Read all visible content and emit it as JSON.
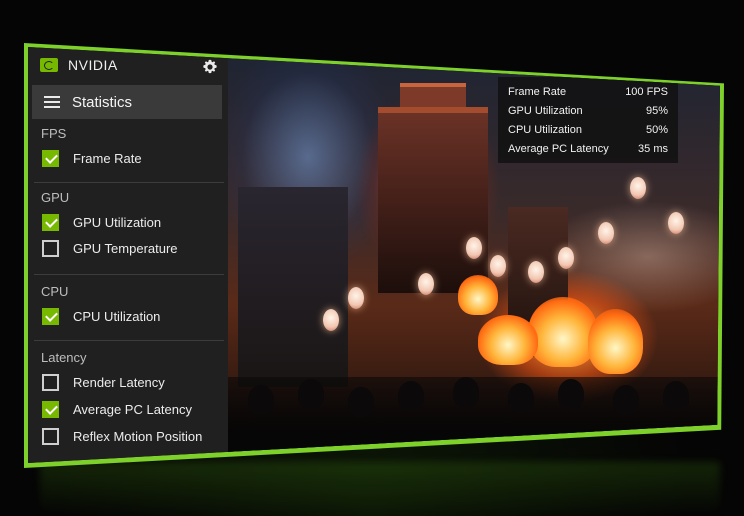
{
  "app": {
    "brand": "NVIDIA",
    "accent_color": "#76b900",
    "menu_icon": "hamburger-menu-icon",
    "settings_icon": "gear-icon"
  },
  "panel": {
    "title": "Statistics",
    "sections": [
      {
        "label": "FPS",
        "options": [
          {
            "label": "Frame Rate",
            "checked": true
          }
        ]
      },
      {
        "label": "GPU",
        "options": [
          {
            "label": "GPU Utilization",
            "checked": true
          },
          {
            "label": "GPU Temperature",
            "checked": false
          }
        ]
      },
      {
        "label": "CPU",
        "options": [
          {
            "label": "CPU Utilization",
            "checked": true
          }
        ]
      },
      {
        "label": "Latency",
        "options": [
          {
            "label": "Render Latency",
            "checked": false
          },
          {
            "label": "Average PC Latency",
            "checked": true
          },
          {
            "label": "Reflex Motion Position",
            "checked": false
          }
        ]
      }
    ]
  },
  "overlay": {
    "rows": [
      {
        "label": "Frame Rate",
        "value": "100 FPS"
      },
      {
        "label": "GPU Utilization",
        "value": "95%"
      },
      {
        "label": "CPU Utilization",
        "value": "50%"
      },
      {
        "label": "Average PC Latency",
        "value": "35 ms"
      }
    ]
  }
}
